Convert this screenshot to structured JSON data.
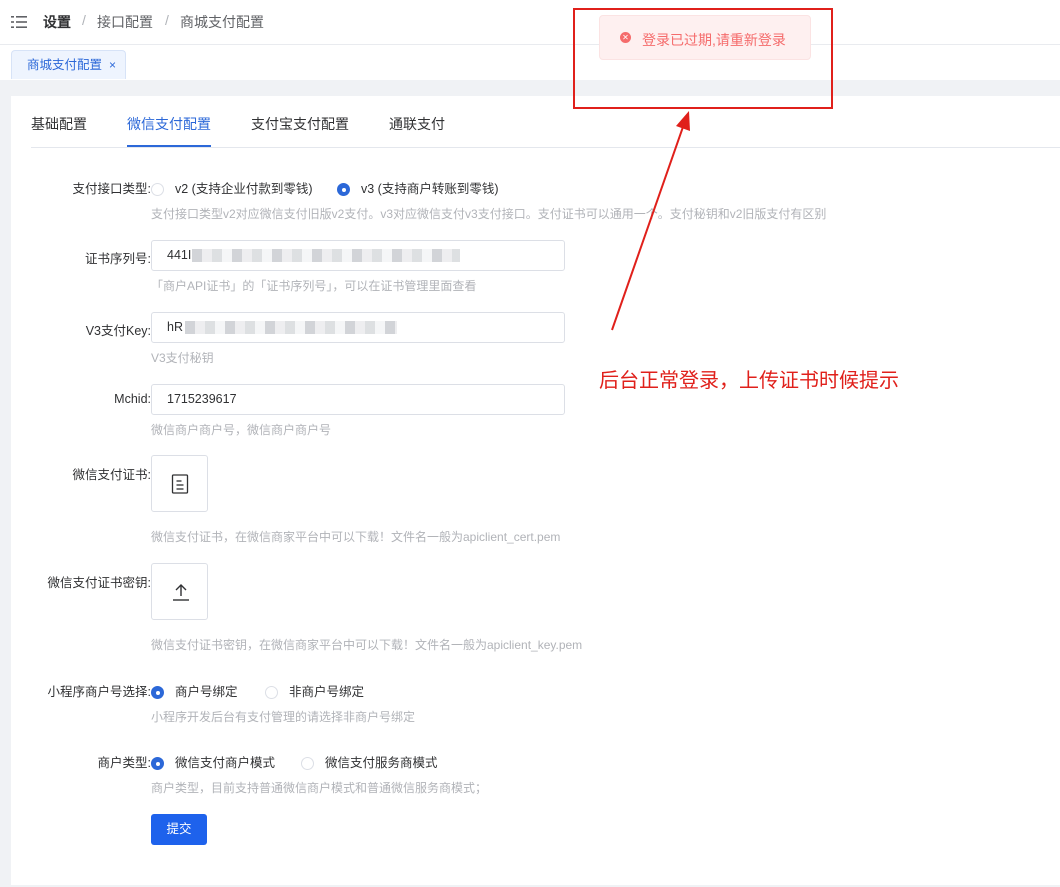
{
  "header": {
    "breadcrumb": [
      "设置",
      "接口配置",
      "商城支付配置"
    ],
    "separator": "/"
  },
  "tags": [
    {
      "label": "商城支付配置",
      "close": "×"
    }
  ],
  "tabs": [
    {
      "label": "基础配置",
      "active": false
    },
    {
      "label": "微信支付配置",
      "active": true
    },
    {
      "label": "支付宝支付配置",
      "active": false
    },
    {
      "label": "通联支付",
      "active": false
    }
  ],
  "form": {
    "api_type": {
      "label": "支付接口类型:",
      "options": [
        "v2 (支持企业付款到零钱)",
        "v3 (支持商户转账到零钱)"
      ],
      "selected": "v3 (支持商户转账到零钱)",
      "help": "支付接口类型v2对应微信支付旧版v2支付。v3对应微信支付v3支付接口。支付证书可以通用一个。支付秘钥和v2旧版支付有区别"
    },
    "cert_serial": {
      "label": "证书序列号:",
      "value": "441I",
      "help": "「商户API证书」的「证书序列号」，可以在证书管理里面查看"
    },
    "v3_key": {
      "label": "V3支付Key:",
      "value": "hR",
      "help": "V3支付秘钥"
    },
    "mchid": {
      "label": "Mchid:",
      "value": "1715239617",
      "help": "微信商户商户号，微信商户商户号"
    },
    "cert": {
      "label": "微信支付证书:",
      "help": "微信支付证书，在微信商家平台中可以下载！文件名一般为apiclient_cert.pem"
    },
    "cert_key": {
      "label": "微信支付证书密钥:",
      "help": "微信支付证书密钥，在微信商家平台中可以下载！文件名一般为apiclient_key.pem"
    },
    "mini_binding": {
      "label": "小程序商户号选择:",
      "options": [
        "商户号绑定",
        "非商户号绑定"
      ],
      "selected": "商户号绑定",
      "help": "小程序开发后台有支付管理的请选择非商户号绑定"
    },
    "merchant_type": {
      "label": "商户类型:",
      "options": [
        "微信支付商户模式",
        "微信支付服务商模式"
      ],
      "selected": "微信支付商户模式",
      "help": "商户类型，目前支持普通微信商户模式和普通微信服务商模式；"
    },
    "submit_label": "提交"
  },
  "toast": {
    "message": "登录已过期,请重新登录",
    "icon": "error-circle-icon"
  },
  "annotation": {
    "text": "后台正常登录，上传证书时候提示",
    "color": "#e0201b"
  },
  "colors": {
    "primary": "#2c68d8",
    "button": "#1e62ec",
    "error": "#f56c6c"
  }
}
